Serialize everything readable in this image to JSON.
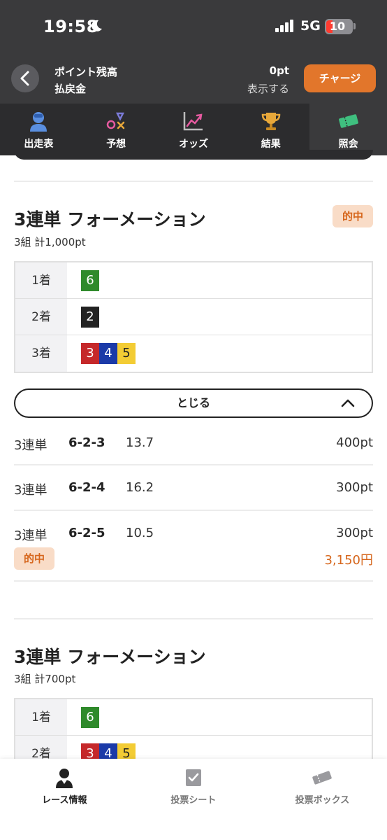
{
  "status_bar": {
    "time": "19:58",
    "network": "5G",
    "battery": "10"
  },
  "header": {
    "points_label": "ポイント残高",
    "points_value": "0pt",
    "refund_label": "払戻金",
    "refund_action": "表示する",
    "charge_button": "チャージ"
  },
  "tabs": [
    {
      "label": "出走表",
      "icon": "racer-icon"
    },
    {
      "label": "予想",
      "icon": "prediction-icon"
    },
    {
      "label": "オッズ",
      "icon": "odds-chart-icon"
    },
    {
      "label": "結果",
      "icon": "trophy-icon"
    },
    {
      "label": "照会",
      "icon": "ticket-icon",
      "active": true
    }
  ],
  "section1": {
    "title": "3連単 フォーメーション",
    "subtitle": "3組 計1,000pt",
    "badge": "的中",
    "rows": [
      {
        "label": "1着",
        "nums": [
          "6"
        ]
      },
      {
        "label": "2着",
        "nums": [
          "2"
        ]
      },
      {
        "label": "3着",
        "nums": [
          "3",
          "4",
          "5"
        ]
      }
    ],
    "toggle_label": "とじる",
    "bets": [
      {
        "type": "3連単",
        "combo": "6-2-3",
        "odds": "13.7",
        "amount": "400pt"
      },
      {
        "type": "3連単",
        "combo": "6-2-4",
        "odds": "16.2",
        "amount": "300pt"
      },
      {
        "type": "3連単",
        "combo": "6-2-5",
        "odds": "10.5",
        "amount": "300pt"
      }
    ],
    "hit_label": "的中",
    "payout": "3,150円"
  },
  "section2": {
    "title": "3連単 フォーメーション",
    "subtitle": "3組 計700pt",
    "rows": [
      {
        "label": "1着",
        "nums": [
          "6"
        ]
      },
      {
        "label": "2着",
        "nums": [
          "3",
          "4",
          "5"
        ]
      }
    ]
  },
  "bottom_nav": [
    {
      "label": "レース情報",
      "icon": "racer-icon",
      "active": true
    },
    {
      "label": "投票シート",
      "icon": "check-sheet-icon"
    },
    {
      "label": "投票ボックス",
      "icon": "tickets-icon"
    }
  ],
  "colors": {
    "accent": "#e2762b",
    "hit_text": "#d6661c",
    "hit_bg": "#f9dcc7",
    "header_bg": "#3a3a3c"
  }
}
